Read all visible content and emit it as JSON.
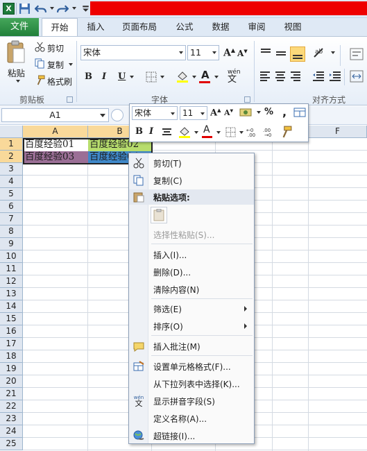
{
  "quick_access": {
    "icons": [
      "excel-logo-icon",
      "save-icon",
      "undo-icon",
      "redo-icon",
      "customize-icon"
    ]
  },
  "ribbon_tabs": [
    "文件",
    "开始",
    "插入",
    "页面布局",
    "公式",
    "数据",
    "审阅",
    "视图"
  ],
  "active_tab": "开始",
  "clipboard": {
    "paste": "粘贴",
    "cut": "剪切",
    "copy": "复制",
    "format_painter": "格式刷",
    "group": "剪贴板"
  },
  "font_group": {
    "font_name": "宋体",
    "font_size": "11",
    "bold": "B",
    "italic": "I",
    "underline": "U",
    "grow": "A",
    "shrink": "A",
    "font_color": "A",
    "phonetic": "wén",
    "group": "字体"
  },
  "alignment_group": {
    "group": "对齐方式"
  },
  "formula_bar": {
    "name_box": "A1"
  },
  "columns": [
    "A",
    "B",
    "",
    "",
    "",
    "F"
  ],
  "rows": [
    "1",
    "2",
    "3",
    "4",
    "5",
    "6",
    "7",
    "8",
    "9",
    "10",
    "11",
    "12",
    "13",
    "14",
    "15",
    "16",
    "17",
    "18",
    "19",
    "20",
    "21",
    "22",
    "23",
    "24",
    "25"
  ],
  "cells": {
    "A1": "百度经验01",
    "B1": "百度经验02",
    "A2": "百度经验03",
    "B2": "百度经验04"
  },
  "cell_colors": {
    "B1": "#b7dd6d",
    "A2": "#9b6f96",
    "B2": "#3f88c9"
  },
  "mini_toolbar": {
    "font_name": "宋体",
    "font_size": "11",
    "percent": "%",
    "comma": ",",
    "bold": "B",
    "italic": "I",
    "grow": "A",
    "shrink": "A",
    "font_color": "A"
  },
  "context_menu": {
    "cut": "剪切(T)",
    "copy": "复制(C)",
    "paste_options": "粘贴选项:",
    "paste_special": "选择性粘贴(S)...",
    "insert": "插入(I)...",
    "delete": "删除(D)...",
    "clear": "清除内容(N)",
    "filter": "筛选(E)",
    "sort": "排序(O)",
    "insert_comment": "插入批注(M)",
    "format_cells": "设置单元格格式(F)...",
    "pick_list": "从下拉列表中选择(K)...",
    "phonetic": "显示拼音字段(S)",
    "define_name": "定义名称(A)...",
    "hyperlink": "超链接(I)..."
  }
}
